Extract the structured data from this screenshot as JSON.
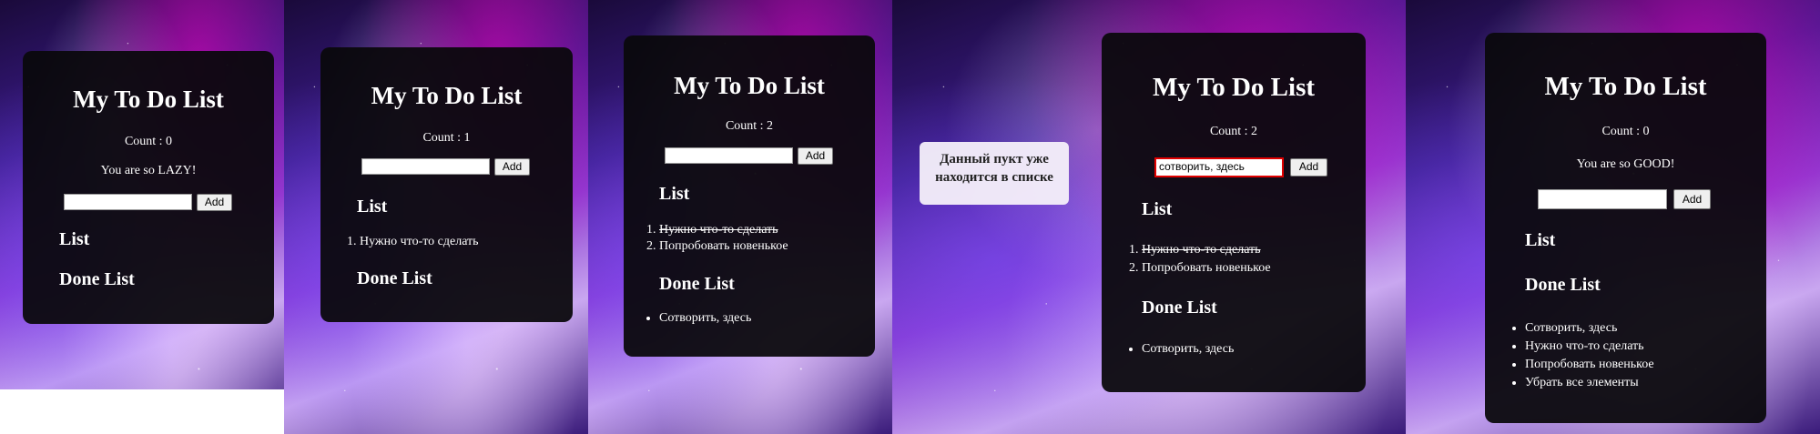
{
  "screens": [
    {
      "title": "My To Do List",
      "count": "Count : 0",
      "message": "You are so LAZY!",
      "input_value": "",
      "add_label": "Add",
      "list_heading": "List",
      "done_heading": "Done List",
      "list_items": [],
      "done_items": []
    },
    {
      "title": "My To Do List",
      "count": "Count : 1",
      "input_value": "",
      "add_label": "Add",
      "list_heading": "List",
      "done_heading": "Done List",
      "list_items": [
        "Нужно что-то сделать"
      ],
      "done_items": []
    },
    {
      "title": "My To Do List",
      "count": "Count : 2",
      "input_value": "",
      "add_label": "Add",
      "list_heading": "List",
      "done_heading": "Done List",
      "list_items": [
        "Нужно что-то сделать",
        "Попробовать новенькое"
      ],
      "done_items": [
        "Сотворить, здесь"
      ]
    },
    {
      "title": "My To Do List",
      "count": "Count : 2",
      "input_value": "сотворить, здесь",
      "add_label": "Add",
      "list_heading": "List",
      "done_heading": "Done List",
      "list_items": [
        "Нужно что-то сделать",
        "Попробовать новенькое"
      ],
      "done_items": [
        "Сотворить, здесь"
      ],
      "toast": "Данный пукт уже находится в списке"
    },
    {
      "title": "My To Do List",
      "count": "Count : 0",
      "message": "You are so GOOD!",
      "input_value": "",
      "add_label": "Add",
      "list_heading": "List",
      "done_heading": "Done List",
      "list_items": [],
      "done_items": [
        "Сотворить, здесь",
        "Нужно что-то сделать",
        "Попробовать новенькое",
        "Убрать все элементы"
      ]
    }
  ]
}
